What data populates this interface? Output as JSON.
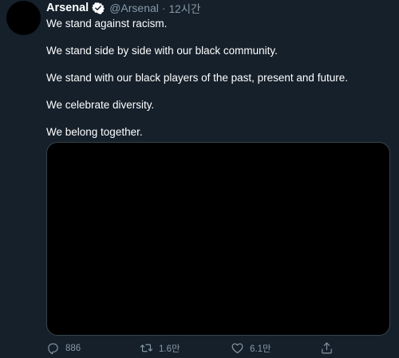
{
  "tweet": {
    "author": {
      "display_name": "Arsenal",
      "handle": "@Arsenal",
      "verified": true
    },
    "separator": "·",
    "time": "12시간",
    "lines": [
      "We stand against racism.",
      "We stand side by side with our black community.",
      "We stand with our black players of the past, present and future.",
      "We celebrate diversity.",
      "We belong together."
    ],
    "actions": {
      "reply_count": "886",
      "retweet_count": "1.6만",
      "like_count": "6.1만"
    }
  },
  "colors": {
    "background": "#15202b",
    "secondary_text": "#8899a6",
    "media_border": "#38444d",
    "verified_badge": "#ffffff"
  },
  "icons": [
    "verified-badge-icon",
    "reply-icon",
    "retweet-icon",
    "like-icon",
    "share-icon"
  ]
}
